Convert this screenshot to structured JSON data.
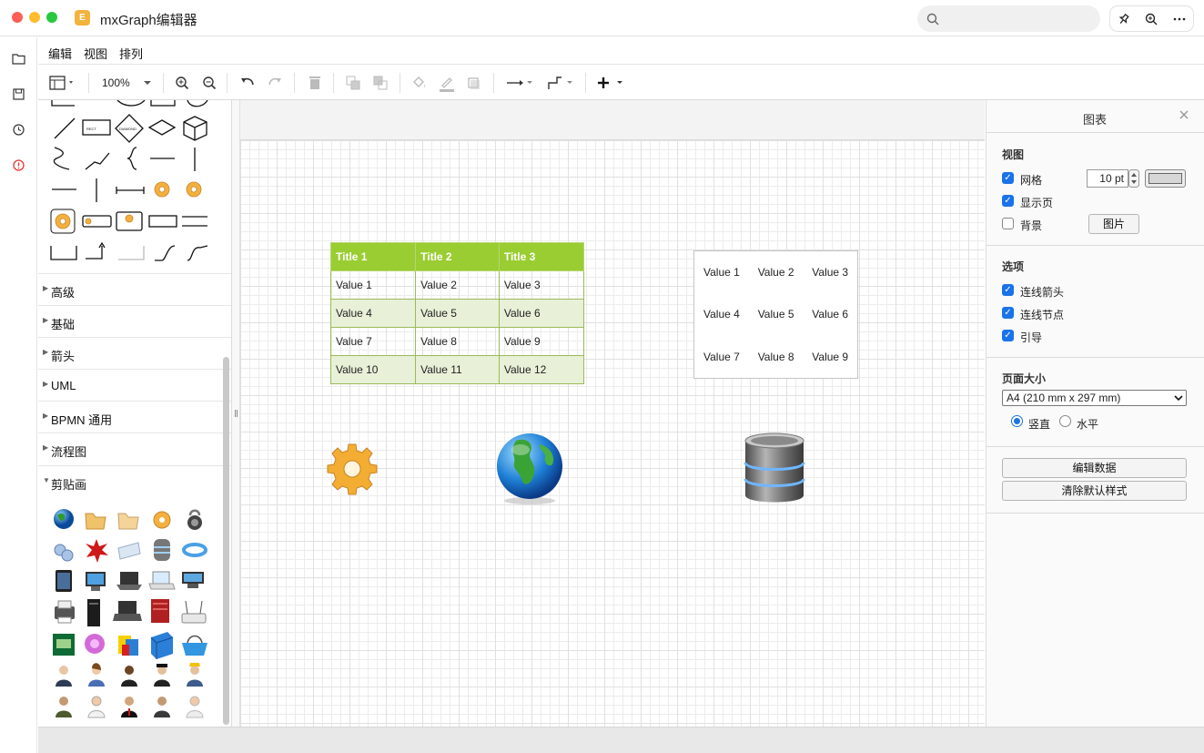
{
  "window": {
    "title": "mxGraph编辑器",
    "app_icon_glyph": "E"
  },
  "titlebar_icons": [
    "pin-icon",
    "zoom-icon",
    "more-icon"
  ],
  "menu": {
    "items": [
      "编辑",
      "视图",
      "排列"
    ]
  },
  "toolbar": {
    "zoom": "100%"
  },
  "sidebar": {
    "sections": [
      "高级",
      "基础",
      "箭头",
      "UML",
      "BPMN 通用",
      "流程图",
      "剪贴画"
    ],
    "expanded_section": "剪贴画",
    "shape_labels": {
      "text": "TEXT",
      "rect": "RECT",
      "diamond": "DIAMOND"
    }
  },
  "canvas": {
    "table1": {
      "headers": [
        "Title 1",
        "Title 2",
        "Title 3"
      ],
      "rows": [
        [
          "Value 1",
          "Value 2",
          "Value 3"
        ],
        [
          "Value 4",
          "Value 5",
          "Value 6"
        ],
        [
          "Value 7",
          "Value 8",
          "Value 9"
        ],
        [
          "Value 10",
          "Value 11",
          "Value 12"
        ]
      ],
      "header_color": "#9acd32",
      "alt_row_color": "#e8f0d8"
    },
    "table2": {
      "rows": [
        [
          "Value 1",
          "Value 2",
          "Value 3"
        ],
        [
          "Value 4",
          "Value 5",
          "Value 6"
        ],
        [
          "Value 7",
          "Value 8",
          "Value 9"
        ]
      ]
    },
    "images": [
      "gear-icon",
      "globe-icon",
      "database-icon"
    ]
  },
  "panel": {
    "title": "图表",
    "view": {
      "heading": "视图",
      "grid_label": "网格",
      "grid_checked": true,
      "grid_size": "10 pt",
      "show_page_label": "显示页",
      "show_page_checked": true,
      "background_label": "背景",
      "background_checked": false,
      "image_button": "图片"
    },
    "options": {
      "heading": "选项",
      "items": [
        {
          "label": "连线箭头",
          "checked": true
        },
        {
          "label": "连线节点",
          "checked": true
        },
        {
          "label": "引导",
          "checked": true
        }
      ]
    },
    "page_size": {
      "heading": "页面大小",
      "selected": "A4 (210 mm x 297 mm)",
      "portrait_label": "竖直",
      "landscape_label": "水平",
      "orientation": "portrait"
    },
    "buttons": {
      "edit_data": "编辑数据",
      "clear_style": "清除默认样式"
    }
  },
  "colors": {
    "accent": "#1a73e8",
    "close_light": "#fe5f57",
    "min_light": "#febc2e",
    "max_light": "#28c840"
  }
}
